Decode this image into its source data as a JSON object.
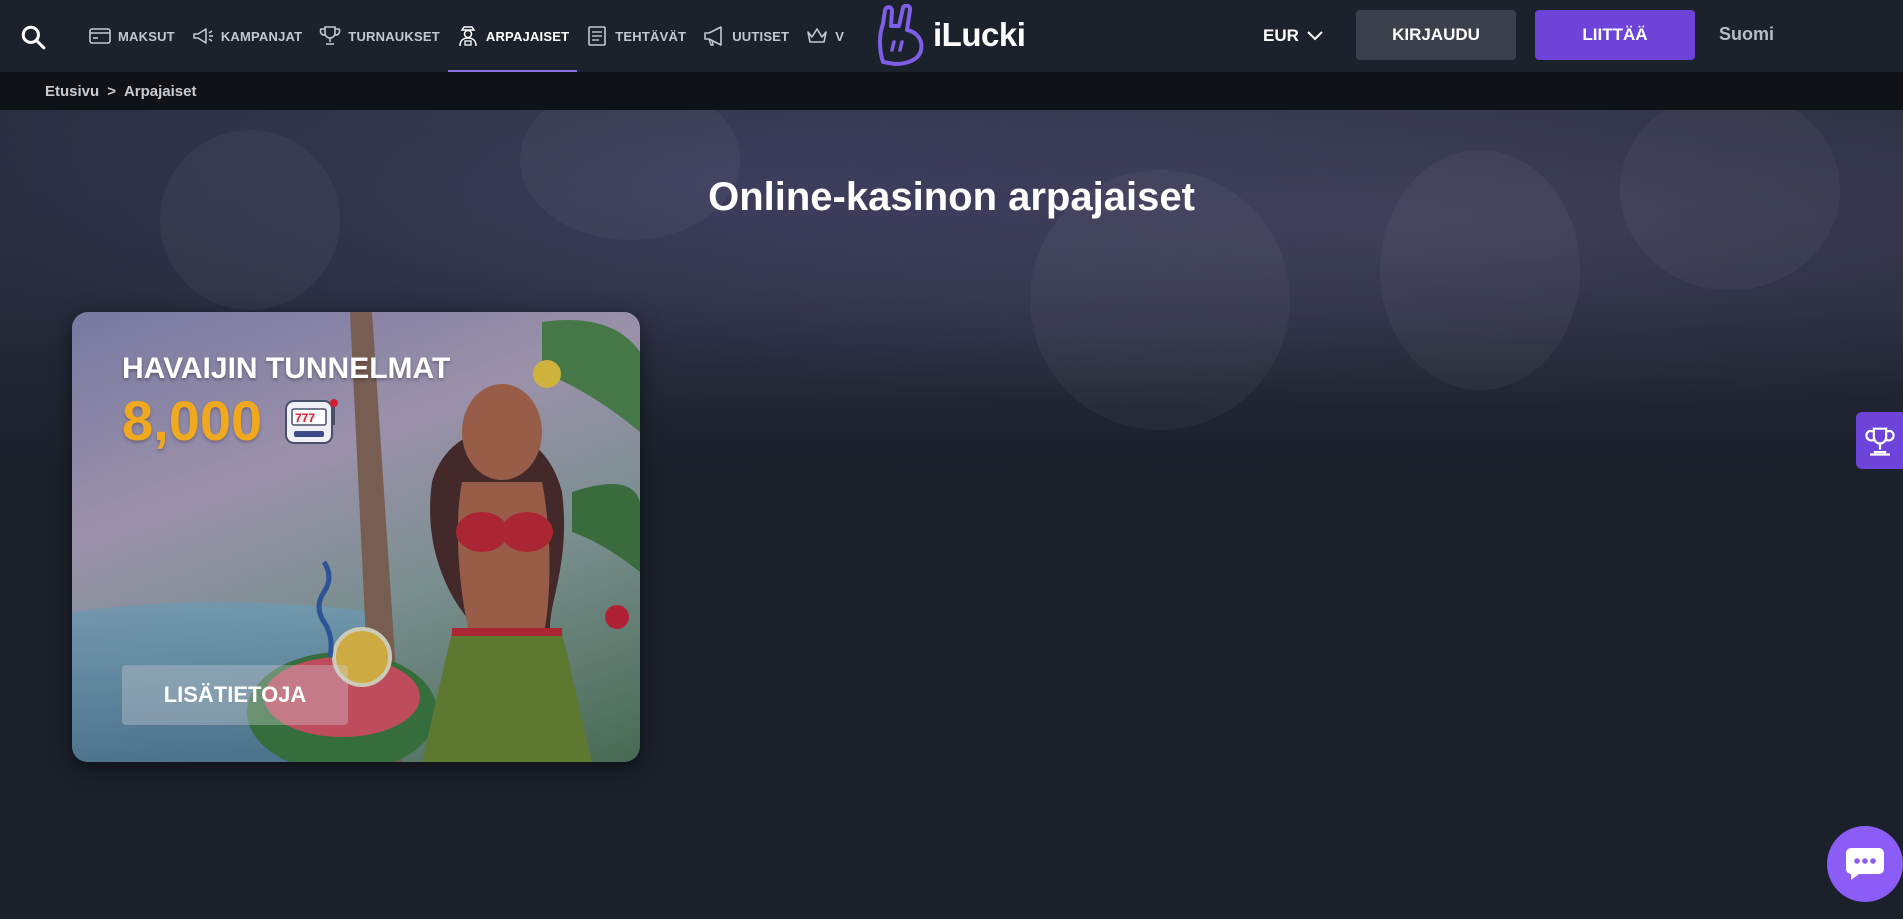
{
  "header": {
    "nav": [
      {
        "label": "MAKSUT",
        "icon": "payments-card-icon"
      },
      {
        "label": "KAMPANJAT",
        "icon": "megaphone-icon"
      },
      {
        "label": "TURNAUKSET",
        "icon": "trophy-icon"
      },
      {
        "label": "ARPAJAISET",
        "icon": "lottery-host-icon",
        "active": true
      },
      {
        "label": "TEHTÄVÄT",
        "icon": "tasks-list-icon"
      },
      {
        "label": "UUTISET",
        "icon": "news-megaphone-icon"
      },
      {
        "label": "V",
        "icon": "crown-icon"
      }
    ],
    "logo_text": "iLucki",
    "currency": "EUR",
    "login_label": "KIRJAUDU",
    "join_label": "LIITTÄÄ",
    "language": "Suomi"
  },
  "breadcrumb": {
    "home": "Etusivu",
    "separator": ">",
    "current": "Arpajaiset"
  },
  "page_title": "Online-kasinon arpajaiset",
  "lottery_card": {
    "title": "HAVAIJIN TUNNELMAT",
    "amount": "8,000",
    "button_label": "LISÄTIETOJA"
  },
  "colors": {
    "accent": "#6d43d9",
    "amount": "#f0a81e",
    "background": "#1b212b",
    "chat": "#8b5cf6"
  }
}
